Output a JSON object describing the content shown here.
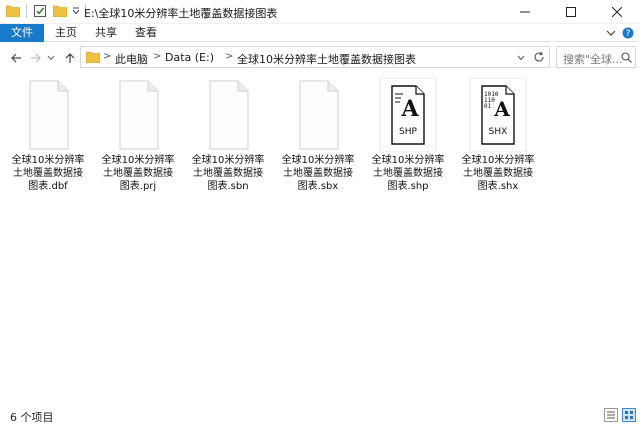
{
  "window": {
    "title": "E:\\全球10米分辨率土地覆盖数据接图表"
  },
  "ribbon": {
    "tabs": [
      "文件",
      "主页",
      "共享",
      "查看"
    ]
  },
  "address": {
    "crumbs": [
      "此电脑",
      "Data (E:)",
      "全球10米分辨率土地覆盖数据接图表"
    ]
  },
  "search": {
    "placeholder": "搜索\"全球..."
  },
  "files": [
    {
      "line1": "全球10米分辨率",
      "line2": "土地覆盖数据接",
      "line3": "图表.dbf",
      "icon": "blank-file-icon"
    },
    {
      "line1": "全球10米分辨率",
      "line2": "土地覆盖数据接",
      "line3": "图表.prj",
      "icon": "blank-file-icon"
    },
    {
      "line1": "全球10米分辨率",
      "line2": "土地覆盖数据接",
      "line3": "图表.sbn",
      "icon": "blank-file-icon"
    },
    {
      "line1": "全球10米分辨率",
      "line2": "土地覆盖数据接",
      "line3": "图表.sbx",
      "icon": "blank-file-icon"
    },
    {
      "line1": "全球10米分辨率",
      "line2": "土地覆盖数据接",
      "line3": "图表.shp",
      "icon": "shp-file-icon",
      "badge": "SHP"
    },
    {
      "line1": "全球10米分辨率",
      "line2": "土地覆盖数据接",
      "line3": "图表.shx",
      "icon": "shx-file-icon",
      "badge": "SHX"
    }
  ],
  "status": {
    "item_count": "6 个项目"
  },
  "colors": {
    "accent": "#1979ca",
    "folder": "#f0c040"
  }
}
